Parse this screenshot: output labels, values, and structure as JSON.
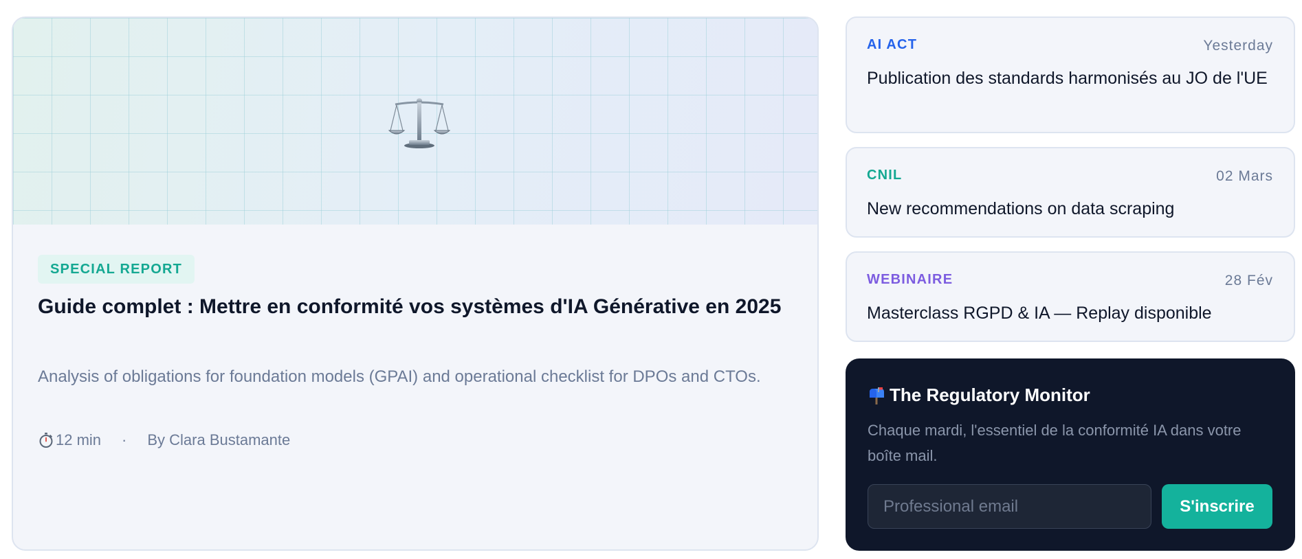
{
  "featured": {
    "badge": "SPECIAL REPORT",
    "title": "Guide complet : Mettre en conformité vos systèmes d'IA Générative en 2025",
    "description": "Analysis of obligations for foundation models (GPAI) and operational checklist for DPOs and CTOs.",
    "read_time": "12 min",
    "separator": "·",
    "author": "By Clara Bustamante",
    "hero_icon": "balance-scale-icon",
    "meta_icon": "stopwatch-icon"
  },
  "news": [
    {
      "category": "AI ACT",
      "category_color": "#2563eb",
      "date": "Yesterday",
      "headline": "Publication des standards harmonisés au JO de l'UE"
    },
    {
      "category": "CNIL",
      "category_color": "#14a892",
      "date": "02 Mars",
      "headline": "New recommendations on data scraping"
    },
    {
      "category": "WEBINAIRE",
      "category_color": "#7c5ce0",
      "date": "28 Fév",
      "headline": "Masterclass RGPD & IA — Replay disponible"
    }
  ],
  "newsletter": {
    "icon": "mailbox-icon",
    "title": "The Regulatory Monitor",
    "description": "Chaque mardi, l'essentiel de la conformité IA dans votre boîte mail.",
    "email_placeholder": "Professional email",
    "email_value": "",
    "button_label": "S'inscrire"
  },
  "colors": {
    "accent": "#14b29c",
    "dark": "#0f172a",
    "muted": "#6b7a96"
  }
}
